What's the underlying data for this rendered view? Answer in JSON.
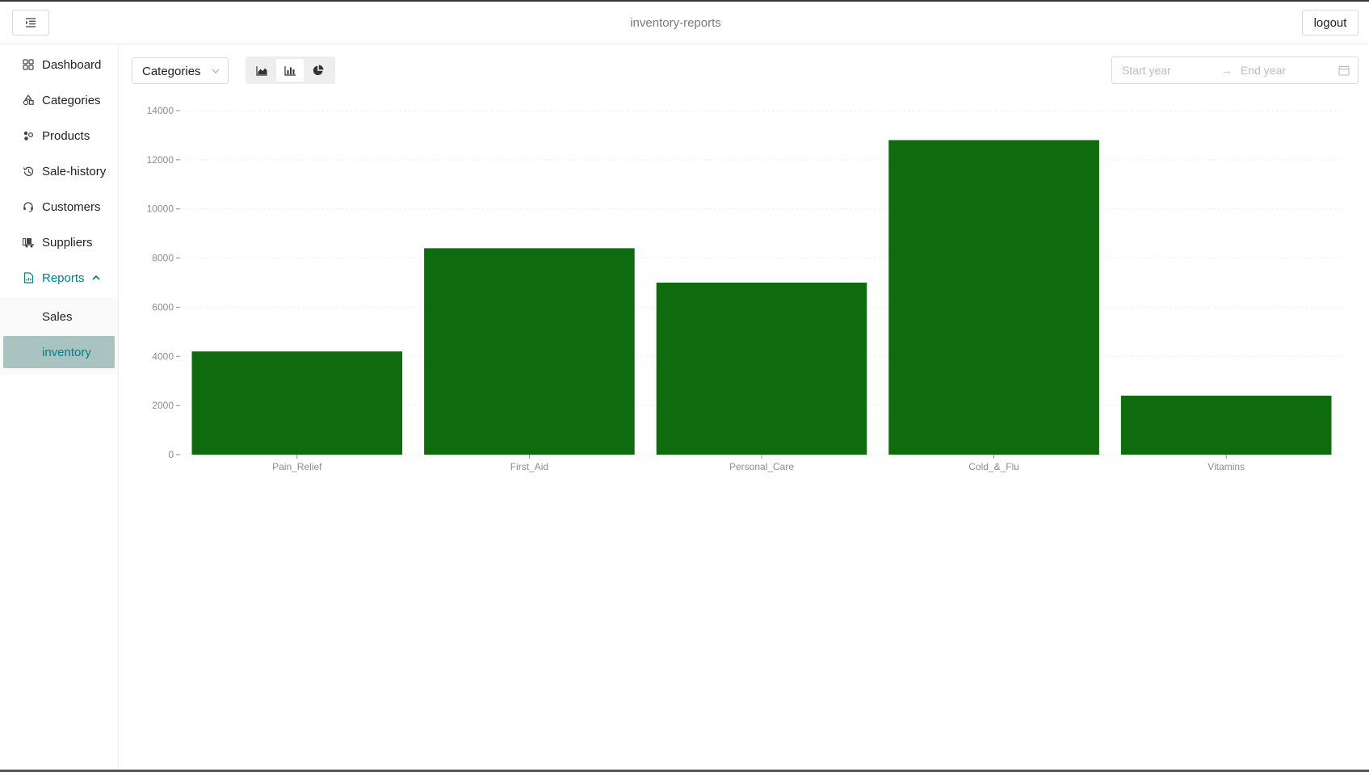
{
  "header": {
    "title": "inventory-reports",
    "logout_label": "logout",
    "menu_icon": "menu-fold-icon"
  },
  "sidebar": {
    "items": [
      {
        "label": "Dashboard",
        "icon": "dashboard-icon"
      },
      {
        "label": "Categories",
        "icon": "shapes-icon"
      },
      {
        "label": "Products",
        "icon": "products-icon"
      },
      {
        "label": "Sale-history",
        "icon": "history-icon"
      },
      {
        "label": "Customers",
        "icon": "headset-icon"
      },
      {
        "label": "Suppliers",
        "icon": "truck-icon"
      },
      {
        "label": "Reports",
        "icon": "file-chart-icon",
        "expanded": true
      }
    ],
    "subitems": [
      {
        "label": "Sales"
      },
      {
        "label": "inventory",
        "selected": true
      }
    ]
  },
  "toolbar": {
    "group_by": "Categories",
    "chart_types": [
      "area-chart-icon",
      "bar-chart-icon",
      "pie-chart-icon"
    ],
    "selected_chart_type": "bar-chart-icon",
    "start_placeholder": "Start year",
    "end_placeholder": "End year"
  },
  "colors": {
    "bar": "#0e6b0e",
    "accent": "#00808a",
    "selected_bg": "#a9c3c1"
  },
  "chart_data": {
    "type": "bar",
    "categories": [
      "Pain_Relief",
      "First_Aid",
      "Personal_Care",
      "Cold_&_Flu",
      "Vitamins"
    ],
    "values": [
      4200,
      8400,
      7000,
      12800,
      2400
    ],
    "ylim": [
      0,
      14000
    ],
    "yticks": [
      0,
      2000,
      4000,
      6000,
      8000,
      10000,
      12000,
      14000
    ],
    "grid": true,
    "title": "",
    "xlabel": "",
    "ylabel": ""
  }
}
